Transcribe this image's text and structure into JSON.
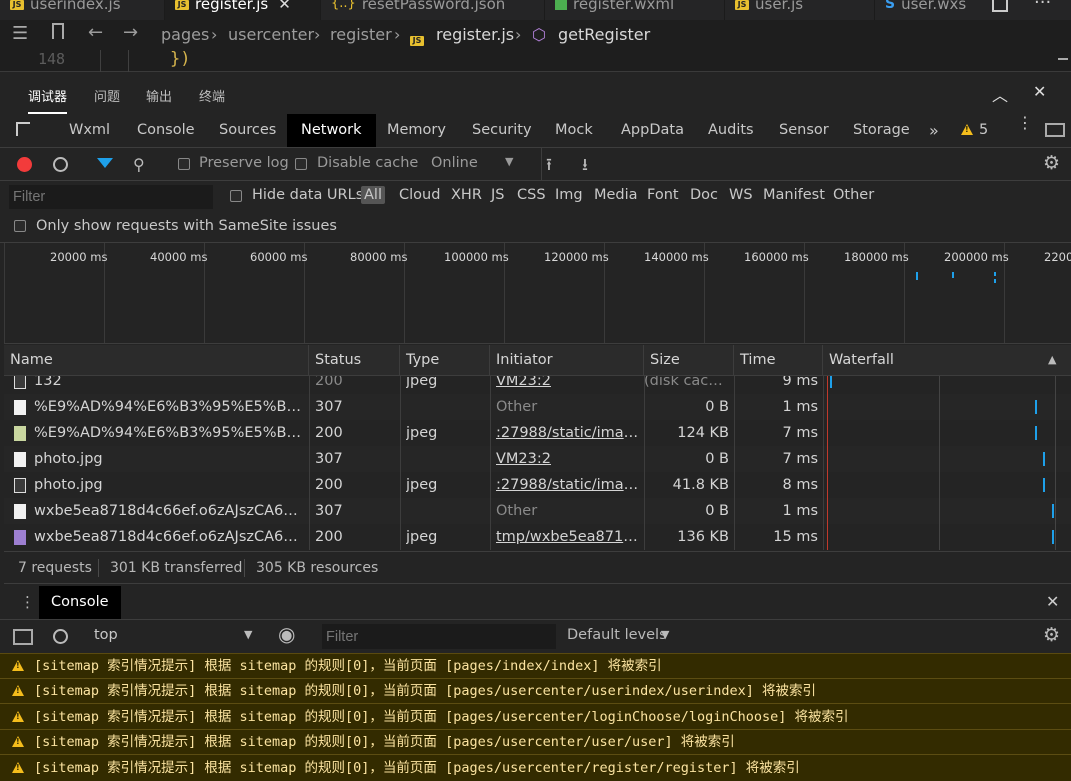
{
  "editor": {
    "tabs": [
      {
        "label": "userindex.js",
        "kind": "js"
      },
      {
        "label": "register.js",
        "kind": "js",
        "active": true
      },
      {
        "label": "resetPassword.json",
        "kind": "json"
      },
      {
        "label": "register.wxml",
        "kind": "wxml"
      },
      {
        "label": "user.js",
        "kind": "js"
      },
      {
        "label": "user.wxs",
        "kind": "wxs"
      }
    ],
    "breadcrumb": [
      "pages",
      "usercenter",
      "register",
      "register.js",
      "getRegister"
    ],
    "line_number": "148",
    "code": "})"
  },
  "debugger_tabs": [
    "调试器",
    "问题",
    "输出",
    "终端"
  ],
  "panel_tabs": [
    "Wxml",
    "Console",
    "Sources",
    "Network",
    "Memory",
    "Security",
    "Mock",
    "AppData",
    "Audits",
    "Sensor",
    "Storage"
  ],
  "active_panel": "Network",
  "warning_count": "5",
  "network_toolbar": {
    "preserve_log": "Preserve log",
    "disable_cache": "Disable cache",
    "throttle": "Online"
  },
  "filter_bar": {
    "placeholder": "Filter",
    "hide_data_urls": "Hide data URLs",
    "types": [
      "All",
      "Cloud",
      "XHR",
      "JS",
      "CSS",
      "Img",
      "Media",
      "Font",
      "Doc",
      "WS",
      "Manifest",
      "Other"
    ]
  },
  "samesite_label": "Only show requests with SameSite issues",
  "overview_ticks": [
    "20000 ms",
    "40000 ms",
    "60000 ms",
    "80000 ms",
    "100000 ms",
    "120000 ms",
    "140000 ms",
    "160000 ms",
    "180000 ms",
    "200000 ms",
    "2200"
  ],
  "table": {
    "columns": [
      "Name",
      "Status",
      "Type",
      "Initiator",
      "Size",
      "Time",
      "Waterfall"
    ],
    "rows": [
      {
        "name": "132",
        "status": "200",
        "type": "jpeg",
        "initiator": "VM23:2",
        "size": "(disk cache)",
        "time": "9 ms"
      },
      {
        "name": "%E9%AD%94%E6%B3%95%E5%B0%9...",
        "status": "307",
        "type": "",
        "initiator": "Other",
        "size": "0 B",
        "time": "1 ms"
      },
      {
        "name": "%E9%AD%94%E6%B3%95%E5%B0%9...",
        "status": "200",
        "type": "jpeg",
        "initiator": ":27988/static/image...",
        "size": "124 KB",
        "time": "7 ms"
      },
      {
        "name": "photo.jpg",
        "status": "307",
        "type": "",
        "initiator": "VM23:2",
        "size": "0 B",
        "time": "7 ms"
      },
      {
        "name": "photo.jpg",
        "status": "200",
        "type": "jpeg",
        "initiator": ":27988/static/image...",
        "size": "41.8 KB",
        "time": "8 ms"
      },
      {
        "name": "wxbe5ea8718d4c66ef.o6zAJszCA6o_M...",
        "status": "307",
        "type": "",
        "initiator": "Other",
        "size": "0 B",
        "time": "1 ms"
      },
      {
        "name": "wxbe5ea8718d4c66ef.o6zAJszCA6o_M...",
        "status": "200",
        "type": "jpeg",
        "initiator": "tmp/wxbe5ea8718...",
        "size": "136 KB",
        "time": "15 ms"
      }
    ]
  },
  "summary": {
    "requests": "7 requests",
    "transferred": "301 KB transferred",
    "resources": "305 KB resources"
  },
  "console": {
    "tab": "Console",
    "context": "top",
    "filter_placeholder": "Filter",
    "levels": "Default levels",
    "messages": [
      "[sitemap 索引情况提示] 根据 sitemap 的规则[0]，当前页面 [pages/index/index] 将被索引",
      "[sitemap 索引情况提示] 根据 sitemap 的规则[0]，当前页面 [pages/usercenter/userindex/userindex] 将被索引",
      "[sitemap 索引情况提示] 根据 sitemap 的规则[0]，当前页面 [pages/usercenter/loginChoose/loginChoose] 将被索引",
      "[sitemap 索引情况提示] 根据 sitemap 的规则[0]，当前页面 [pages/usercenter/user/user] 将被索引",
      "[sitemap 索引情况提示] 根据 sitemap 的规则[0]，当前页面 [pages/usercenter/register/register] 将被索引"
    ]
  },
  "colors": {
    "accent_blue": "#1ea0ea",
    "warning": "#f4bd1c",
    "record": "#f23b3b"
  }
}
